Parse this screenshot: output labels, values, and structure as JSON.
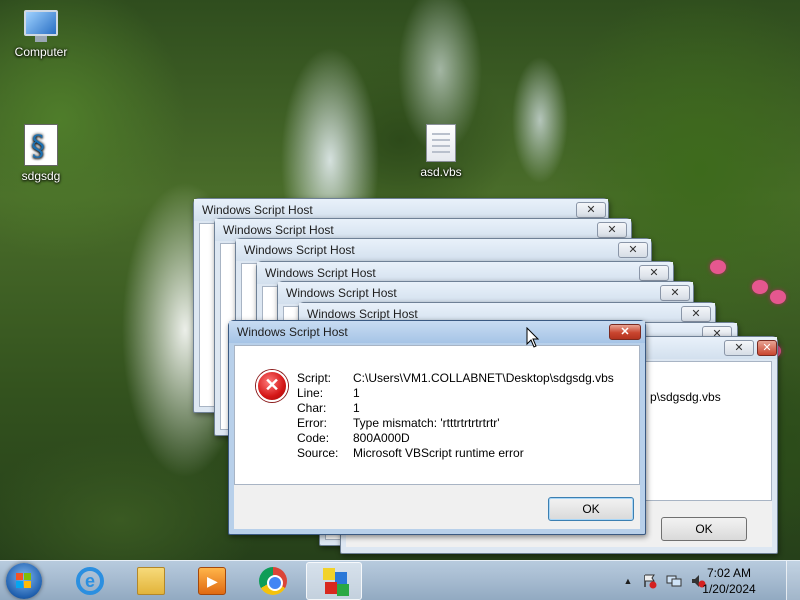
{
  "desktop": {
    "icons": [
      {
        "label": "Computer",
        "icon": "computer-icon"
      },
      {
        "label": "sdgsdg",
        "icon": "vbs-script-icon"
      },
      {
        "label": "asd.vbs",
        "icon": "text-file-icon"
      }
    ]
  },
  "dialogs": {
    "title": "Windows Script Host",
    "close_glyph": "✕",
    "behind": {
      "partial_text": "p\\sdgsdg.vbs",
      "ok_label": "OK"
    },
    "active": {
      "title": "Windows Script Host",
      "close_glyph": "✕",
      "error_icon": "error-icon",
      "error_glyph": "✕",
      "fields": [
        {
          "label": "Script:",
          "value": "C:\\Users\\VM1.COLLABNET\\Desktop\\sdgsdg.vbs"
        },
        {
          "label": "Line:",
          "value": "1"
        },
        {
          "label": "Char:",
          "value": "1"
        },
        {
          "label": "Error:",
          "value": "Type mismatch: 'rtttrtrtrtrtrtr'"
        },
        {
          "label": "Code:",
          "value": "800A000D"
        },
        {
          "label": "Source:",
          "value": "Microsoft VBScript runtime error"
        }
      ],
      "ok_label": "OK"
    }
  },
  "taskbar": {
    "items": [
      {
        "name": "internet-explorer",
        "icon": "internet-explorer-icon"
      },
      {
        "name": "windows-explorer",
        "icon": "folder-icon"
      },
      {
        "name": "media-player",
        "icon": "media-player-icon"
      },
      {
        "name": "chrome",
        "icon": "chrome-icon"
      },
      {
        "name": "script-app",
        "icon": "blocks-app-icon"
      }
    ],
    "ie_glyph": "e",
    "tray": {
      "show_hidden_glyph": "▲",
      "clock_time": "7:02 AM",
      "clock_date": "1/20/2024"
    }
  },
  "colors": {
    "title_bar": "#d3e0ee",
    "active_title_bar": "#a6c4e6",
    "close_red": "#c9452f",
    "taskbar": "#8ca5be"
  }
}
